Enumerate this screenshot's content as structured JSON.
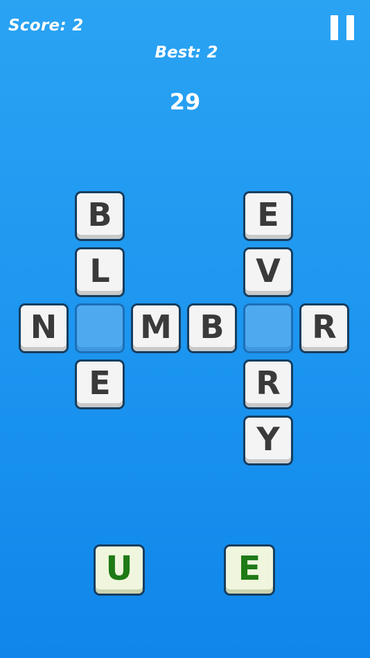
{
  "hud": {
    "score_text": "Score: 2",
    "best_text": "Best: 2",
    "timer": "29"
  },
  "board": {
    "b1": "B",
    "l1": "L",
    "n1": "N",
    "e1": "E",
    "m1": "M",
    "b2": "B",
    "r1": "R",
    "e2": "E",
    "v1": "V",
    "r2": "R",
    "y1": "Y"
  },
  "hand": {
    "u": "U",
    "e": "E"
  },
  "icons": {
    "pause": "pause-icon"
  },
  "colors": {
    "background": "#1b95f0",
    "tile": "#f4f4f4",
    "tile_border": "#173d5e",
    "empty_slot": "#4fa9ee",
    "hand_letter": "#1e7a16"
  }
}
